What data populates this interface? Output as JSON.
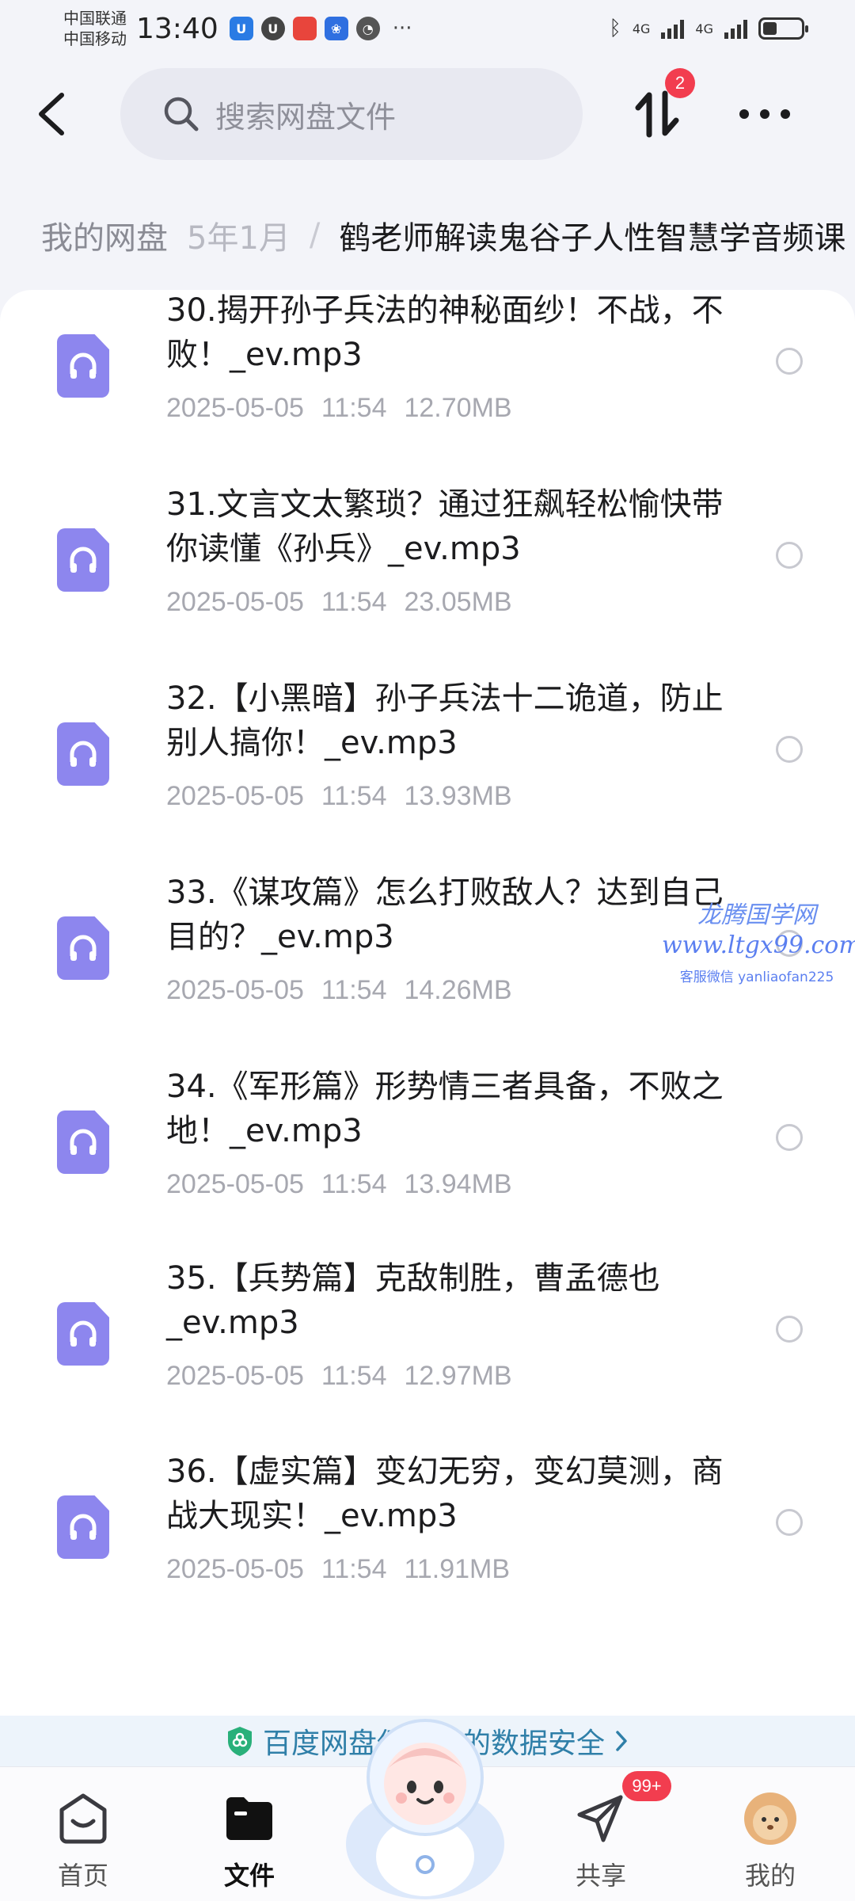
{
  "status_bar": {
    "carrier_1": "中国联通",
    "carrier_2": "中国移动",
    "time": "13:40",
    "more": "···",
    "network_1": "4G",
    "network_2": "4G"
  },
  "top_bar": {
    "search_placeholder": "搜索网盘文件",
    "transfer_badge": "2"
  },
  "breadcrumb": {
    "root": "我的网盘",
    "previous": "5年1月",
    "separator": "/",
    "current": "鹤老师解读鬼谷子人性智慧学音频课"
  },
  "files": [
    {
      "name": "30.揭开孙子兵法的神秘面纱！不战，不败！_ev.mp3",
      "date": "2025-05-05",
      "time": "11:54",
      "size": "12.70MB"
    },
    {
      "name": "31.文言文太繁琐？通过狂飙轻松愉快带你读懂《孙兵》_ev.mp3",
      "date": "2025-05-05",
      "time": "11:54",
      "size": "23.05MB"
    },
    {
      "name": "32.【小黑暗】孙子兵法十二诡道，防止别人搞你！_ev.mp3",
      "date": "2025-05-05",
      "time": "11:54",
      "size": "13.93MB"
    },
    {
      "name": "33.《谋攻篇》怎么打败敌人？达到自己目的？_ev.mp3",
      "date": "2025-05-05",
      "time": "11:54",
      "size": "14.26MB"
    },
    {
      "name": "34.《军形篇》形势情三者具备，不败之地！_ev.mp3",
      "date": "2025-05-05",
      "time": "11:54",
      "size": "13.94MB"
    },
    {
      "name": "35.【兵势篇】克敌制胜，曹孟德也_ev.mp3",
      "date": "2025-05-05",
      "time": "11:54",
      "size": "12.97MB"
    },
    {
      "name": "36.【虚实篇】变幻无穷，变幻莫测，商战大现实！_ev.mp3",
      "date": "2025-05-05",
      "time": "11:54",
      "size": "11.91MB"
    }
  ],
  "watermark": {
    "title": "龙腾国学网",
    "url": "www.ltgx99.com",
    "contact": "客服微信 yanliaofan225"
  },
  "security_banner": {
    "text": "百度网盘保护您的数据安全",
    "color": "#2f7fa8"
  },
  "bottom_nav": {
    "home": "首页",
    "files": "文件",
    "share": "共享",
    "mine": "我的",
    "share_badge": "99+"
  },
  "colors": {
    "file_icon": "#8d86ee",
    "badge": "#f23d4f"
  }
}
